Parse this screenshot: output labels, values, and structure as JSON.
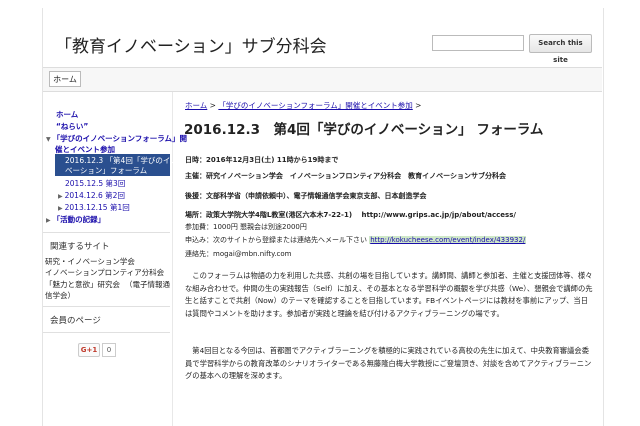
{
  "site": {
    "title": "「教育イノベーション」サブ分科会"
  },
  "search": {
    "placeholder": "",
    "button_label": "Search this site"
  },
  "nav": {
    "home_tab": "ホーム"
  },
  "sidebar": {
    "items": [
      {
        "label": "ホーム"
      },
      {
        "label": "“ねらい”"
      },
      {
        "label": "「学びのイノベーションフォーラム」開"
      },
      {
        "label": "催とイベント参加"
      },
      {
        "label": "2016.12.3 「第4回「学びのイノ"
      },
      {
        "label": "ベーション」フォーラム"
      },
      {
        "label": "2015.12.5 第3回"
      },
      {
        "label": "2014.12.6 第2回"
      },
      {
        "label": "2013.12.15 第1回"
      },
      {
        "label": "「活動の記録」"
      }
    ],
    "related_heading": "関連するサイト",
    "related": [
      {
        "label": "研究・イノベーション学会"
      },
      {
        "label": "イノベーションプロンティア分科会"
      },
      {
        "label": "「魅力と意欲」研究会"
      },
      {
        "label": "（電子情報通"
      },
      {
        "label": "信学会）"
      }
    ],
    "members_heading": "会員のページ",
    "gplus": {
      "label": "G+1",
      "count": "0"
    }
  },
  "breadcrumb": {
    "home": "ホーム",
    "sep1": ">",
    "parent": "「学びのイノベーションフォーラム」開催とイベント参加",
    "sep2": ">"
  },
  "page": {
    "title": "2016.12.3　第4回「学びのイノベーション」 フォーラム",
    "date_line": "日時：2016年12月3日(土)  11時から19時まで",
    "organizer_line": "主催：研究イノベーション学会　イノベーションフロンティア分科会　教育イノベーションサブ分科会",
    "support_line": "後援：文部科学省（申請依頼中）、電子情報通信学会東京支部、日本創造学会",
    "venue_line": "場所：政策大学院大学4階L教室(港区六本木7-22-1)　 http://www.grips.ac.jp/jp/about/access/",
    "fee_line": "参加費：1000円  懇親会は別途2000円",
    "apply_prefix": "申込み：次のサイトから登録または連絡先へメール下さい",
    "apply_link": "http://kokucheese.com/event/index/433932/",
    "contact_line": "連絡先：mogai@mbn.nifty.com",
    "paragraph1": "　このフォーラムは物語の力を利用した共感、共創の場を目指しています。講師間、講師と参加者、主催と支援団体等、様々な組み合わせで。仲間の生の実践報告（Self）に加え、その基本となる学習科学の概観を学び共感（We）、懇親会で講師の先生と話すことで共創（Now）のテーマを確認することを目指しています。FBイベントページには教材を事前にアップ、当日は質問やコメントを助けます。参加者が実践と理論を結び付けるアクティブラーニングの場です。",
    "paragraph2": "　第4回目となる今回は、首都圏でアクティブラーニングを積極的に実践されている高校の先生に加えて、中央教育審議会委員で学習科学からの教育改革のシナリオライターである無藤隆白梅大学教授にご登壇頂き、対談を含めてアクティブラーニングの基本への理解を深めます。"
  }
}
